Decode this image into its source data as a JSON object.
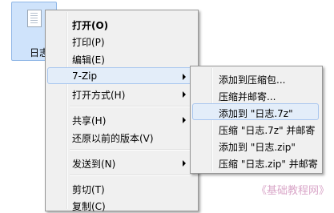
{
  "desktop": {
    "file_name": "日志"
  },
  "context_menu": {
    "items": [
      {
        "label": "打开(O)"
      },
      {
        "label": "打印(P)"
      },
      {
        "label": "编辑(E)"
      },
      {
        "label": "7-Zip"
      },
      {
        "label": "打开方式(H)"
      },
      {
        "label": "共享(H)"
      },
      {
        "label": "还原以前的版本(V)"
      },
      {
        "label": "发送到(N)"
      },
      {
        "label": "剪切(T)"
      },
      {
        "label": "复制(C)"
      }
    ]
  },
  "submenu_7zip": {
    "items": [
      {
        "label": "添加到压缩包..."
      },
      {
        "label": "压缩并邮寄..."
      },
      {
        "label": "添加到 \"日志.7z\""
      },
      {
        "label": "压缩 \"日志.7z\" 并邮寄"
      },
      {
        "label": "添加到 \"日志.zip\""
      },
      {
        "label": "压缩 \"日志.zip\" 并邮寄"
      }
    ]
  },
  "watermark": "《基础教程网》"
}
